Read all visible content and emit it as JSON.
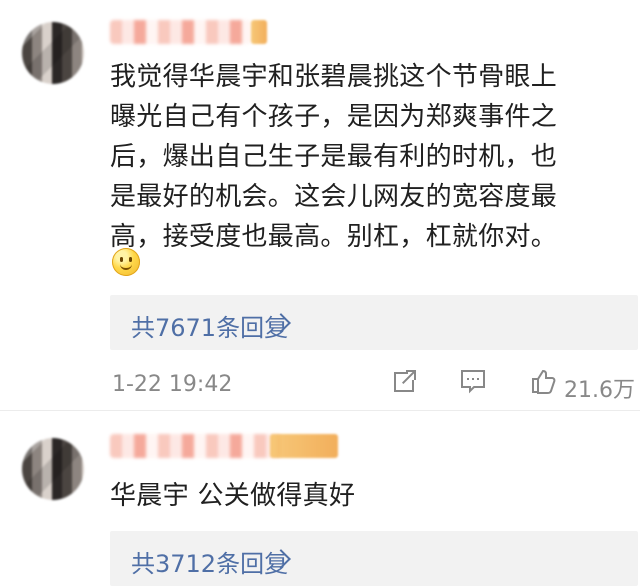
{
  "comments": [
    {
      "text": "我觉得华晨宇和张碧晨挑这个节骨眼上\n曝光自己有个孩子，是因为郑爽事件之\n后，爆出自己生子是最有利的时机，也\n是最好的机会。这会儿网友的宽容度最\n高，接受度也最高。别杠，杠就你对。",
      "reply_label": "共7671条回复",
      "timestamp": "1-22 19:42",
      "likes": "21.6万",
      "emoji": "smile-emoji"
    },
    {
      "text": "华晨宇 公关做得真好",
      "reply_label": "共3712条回复"
    }
  ],
  "icons": {
    "share": "share-icon",
    "comment": "comment-icon",
    "like": "thumbs-up-icon",
    "chevron": "chevron-right-icon"
  },
  "colors": {
    "link": "#4f6fa6",
    "meta": "#888888",
    "reply_bg": "#f2f2f2"
  }
}
